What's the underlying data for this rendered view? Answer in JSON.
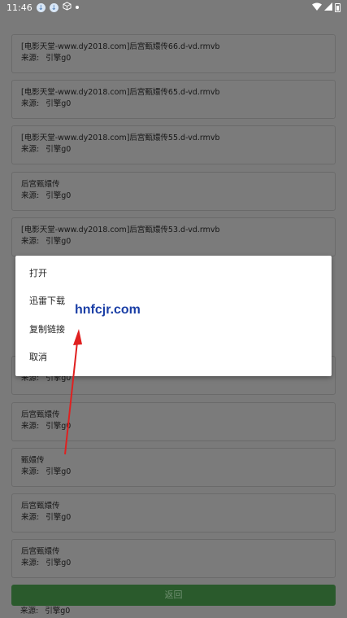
{
  "status_bar": {
    "time": "11:46",
    "notif_icons": [
      "download-icon",
      "download-icon",
      "box-icon"
    ],
    "right_icons": [
      "wifi-icon",
      "signal-icon",
      "battery-icon"
    ]
  },
  "list": [
    {
      "title": "[电影天堂-www.dy2018.com]后宫甄嬛传66.d-vd.rmvb",
      "src_label": "来源:",
      "src_value": "引擎g0"
    },
    {
      "title": "[电影天堂-www.dy2018.com]后宫甄嬛传65.d-vd.rmvb",
      "src_label": "来源:",
      "src_value": "引擎g0"
    },
    {
      "title": "[电影天堂-www.dy2018.com]后宫甄嬛传55.d-vd.rmvb",
      "src_label": "来源:",
      "src_value": "引擎g0"
    },
    {
      "title": "后宫甄嬛传",
      "src_label": "来源:",
      "src_value": "引擎g0"
    },
    {
      "title": "[电影天堂-www.dy2018.com]后宫甄嬛传53.d-vd.rmvb",
      "src_label": "来源:",
      "src_value": "引擎g0"
    },
    {
      "title": "",
      "src_label": "来源:",
      "src_value": "引擎g0"
    },
    {
      "title": "后宫甄嬛传",
      "src_label": "来源:",
      "src_value": "引擎g0"
    },
    {
      "title": "甄嬛传",
      "src_label": "来源:",
      "src_value": "引擎g0"
    },
    {
      "title": "后宫甄嬛传",
      "src_label": "来源:",
      "src_value": "引擎g0"
    },
    {
      "title": "后宫甄嬛传",
      "src_label": "来源:",
      "src_value": "引擎g0"
    }
  ],
  "dialog": {
    "items": [
      "打开",
      "迅雷下载",
      "复制链接",
      "取消"
    ]
  },
  "watermark": "hnfcjr.com",
  "back_button": "返回",
  "bottom_source": {
    "src_label": "来源:",
    "src_value": "引擎g0"
  }
}
